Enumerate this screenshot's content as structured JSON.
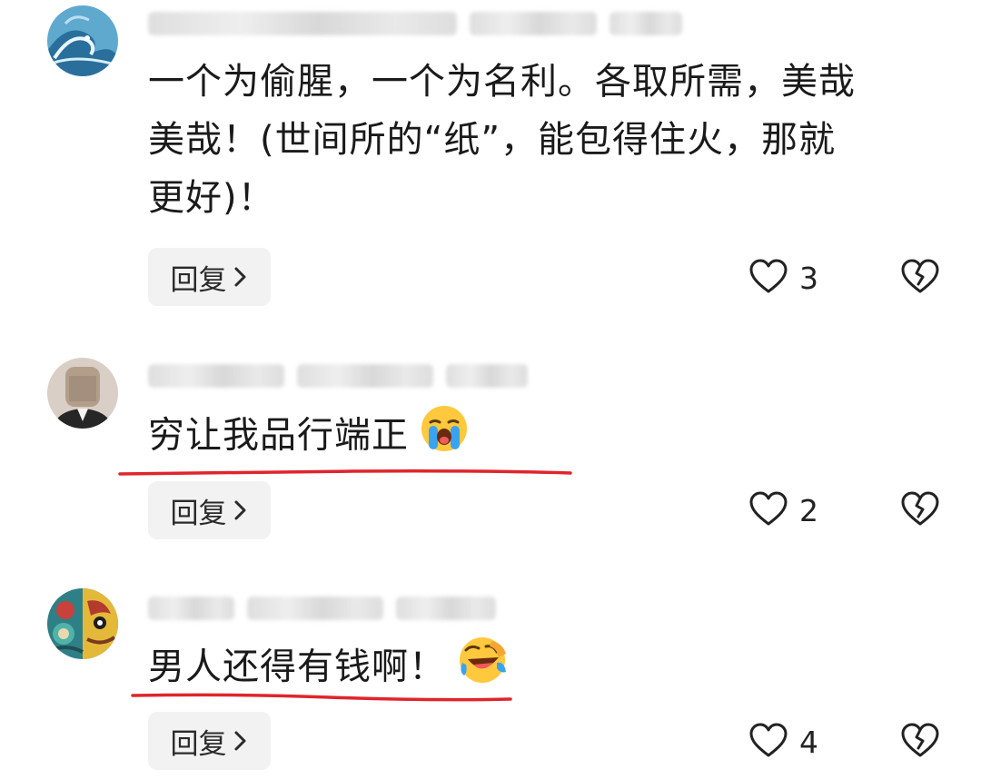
{
  "comments": [
    {
      "text": "一个为偷腥，一个为名利。各取所需，美哉\n美哉！(世间所的“纸”，能包得住火，那就\n更好)！",
      "reply_label": "回复",
      "likes": "3"
    },
    {
      "text": "穷让我品行端正",
      "reply_label": "回复",
      "likes": "2"
    },
    {
      "text": "男人还得有钱啊！",
      "reply_label": "回复",
      "likes": "4"
    }
  ],
  "icons": {
    "avatar_1": "wave-avatar",
    "avatar_2": "person-avatar",
    "avatar_3": "illustrated-avatar",
    "emoji_2": "loudly-crying-emoji",
    "emoji_3": "rolling-laughing-emoji",
    "like": "heart-outline-icon",
    "dislike": "broken-heart-icon",
    "reply_chevron": "chevron-right-icon"
  },
  "colors": {
    "annotation_underline": "#e0242c",
    "reply_bg": "#f2f2f2"
  }
}
